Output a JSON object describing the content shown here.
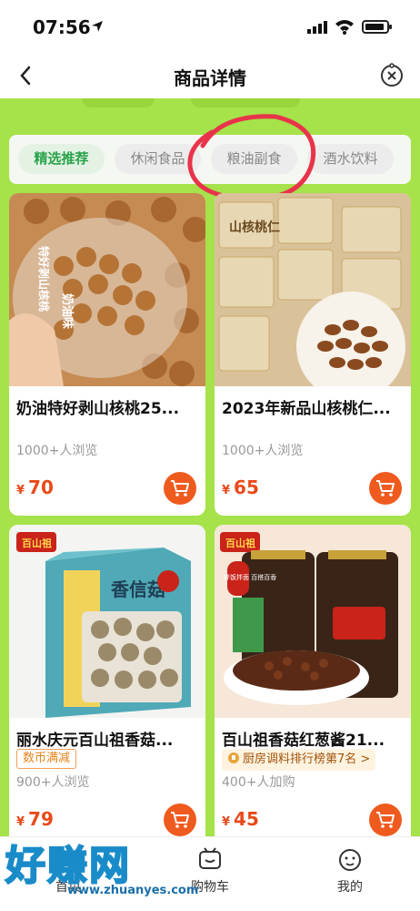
{
  "status_bar": {
    "time": "07:56"
  },
  "nav": {
    "title": "商品详情"
  },
  "tabs": [
    {
      "label": "精选推荐",
      "active": true
    },
    {
      "label": "休闲食品",
      "active": false
    },
    {
      "label": "粮油副食",
      "active": false
    },
    {
      "label": "酒水饮料",
      "active": false
    }
  ],
  "products": [
    {
      "title": "奶油特好剥山核桃25...",
      "views": "1000+人浏览",
      "currency": "¥",
      "price": "70",
      "image_text": [
        "特好剥山核桃",
        "奶油味"
      ]
    },
    {
      "title": "2023年新品山核桃仁...",
      "views": "1000+人浏览",
      "currency": "¥",
      "price": "65",
      "image_text": [
        "山核桃仁"
      ]
    },
    {
      "title": "丽水庆元百山祖香菇...",
      "tag": "数币满减",
      "views": "900+人浏览",
      "currency": "¥",
      "price": "79",
      "image_text": [
        "百山祖",
        "香信菇"
      ]
    },
    {
      "title": "百山祖香菇红葱酱21...",
      "rank_tag": "厨房调料排行榜第7名 >",
      "views": "400+人加购",
      "currency": "¥",
      "price": "45",
      "image_text": [
        "百山祖",
        "拌饭拌面 百搭百香"
      ]
    }
  ],
  "bottom_nav": [
    {
      "label": "首页",
      "icon": "home-icon"
    },
    {
      "label": "购物车",
      "icon": "cart-icon"
    },
    {
      "label": "我的",
      "icon": "profile-icon"
    }
  ],
  "watermark": {
    "text": "好赚网",
    "url": "www.zhuanyes.com"
  },
  "colors": {
    "accent": "#ef5a1e",
    "price": "#e84a1a",
    "banner": "#a6e24a",
    "tab_active": "#2aa34a",
    "annotation": "#e8344a"
  }
}
